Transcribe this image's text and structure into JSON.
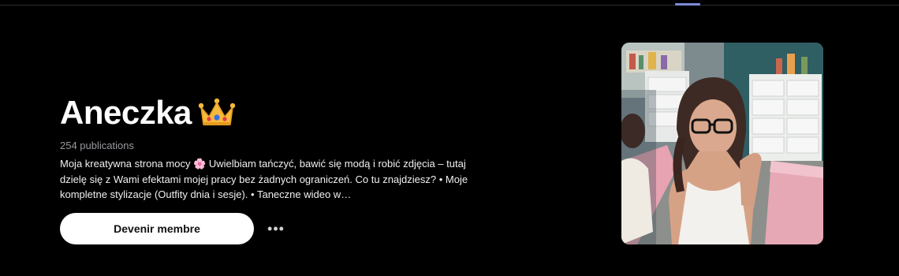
{
  "profile": {
    "name": "Aneczka",
    "crown_emoji": "crown-icon",
    "publications": "254 publications",
    "bio": "Moja kreatywna strona mocy 🌸 Uwielbiam tańczyć, bawić się modą i robić zdjęcia – tutaj dzielę się z Wami efektami mojej pracy bez żadnych ograniczeń. Co tu znajdziesz? • Moje kompletne stylizacje (Outfity dnia i sesje). • Taneczne wideo w…"
  },
  "actions": {
    "join_label": "Devenir membre",
    "more_icon": "more-horizontal-icon"
  },
  "colors": {
    "background": "#000000",
    "button_bg": "#ffffff",
    "tab_indicator": "#7c8bd6"
  }
}
